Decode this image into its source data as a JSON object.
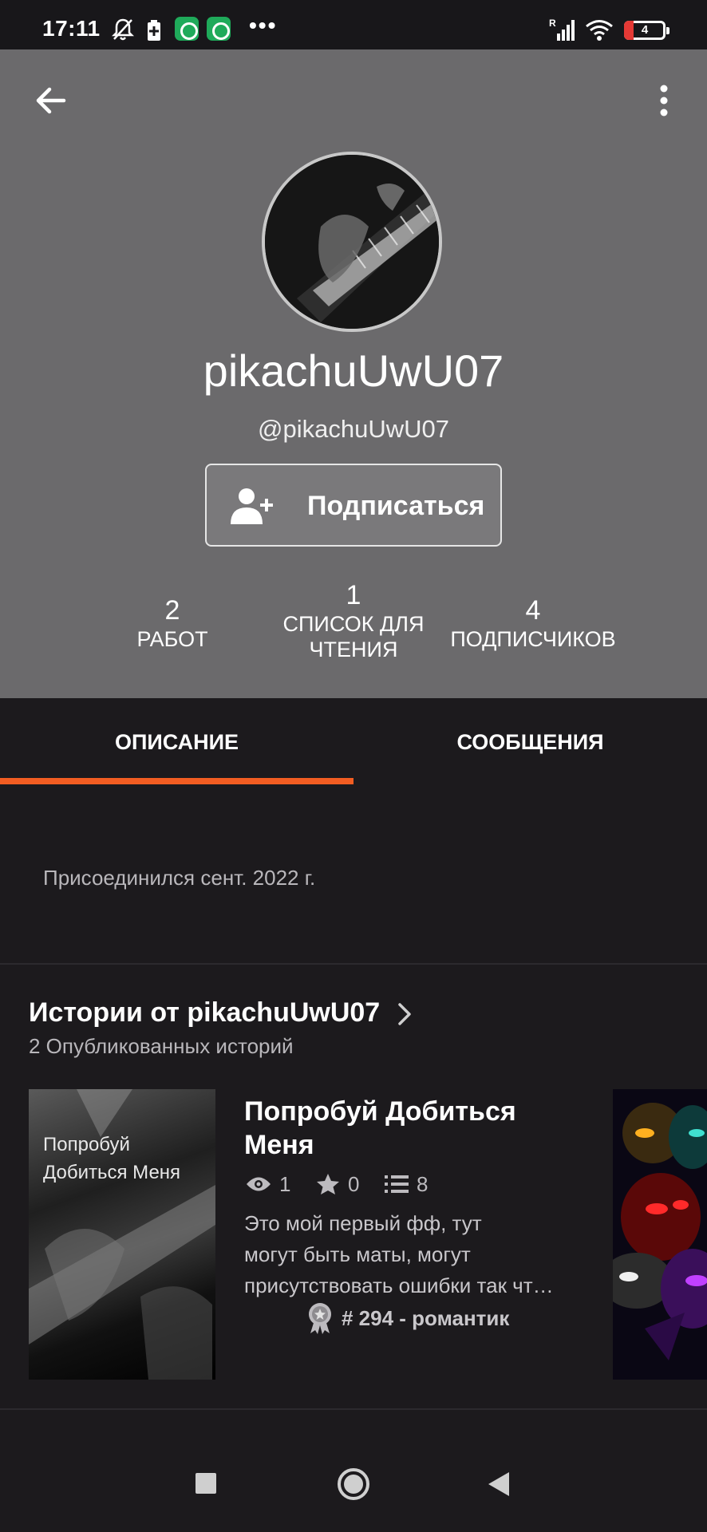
{
  "status_bar": {
    "time": "17:11",
    "battery": "4",
    "icons": [
      "bell-off-icon",
      "battery-saver-icon",
      "app-notification-icon",
      "app-notification-icon",
      "more-dots",
      "signal-icon",
      "wifi-icon",
      "battery-icon"
    ],
    "dots": "•••",
    "signal_badge": "R"
  },
  "header": {
    "display_name": "pikachuUwU07",
    "handle": "@pikachuUwU07",
    "follow_label": "Подписаться",
    "stats": [
      {
        "value": "2",
        "label": "РАБОТ"
      },
      {
        "value": "1",
        "label": "СПИСОК ДЛЯ ЧТЕНИЯ"
      },
      {
        "value": "4",
        "label": "ПОДПИСЧИКОВ"
      }
    ]
  },
  "tabs": [
    {
      "label": "ОПИСАНИЕ",
      "active": true
    },
    {
      "label": "СООБЩЕНИЯ",
      "active": false
    }
  ],
  "about": {
    "joined": "Присоединился сент. 2022 г."
  },
  "stories": {
    "title": "Истории от pikachuUwU07",
    "count": "2 Опубликованных историй",
    "items": [
      {
        "cover_text": "Попробуй Добиться Меня",
        "title": "Попробуй Добиться Меня",
        "reads": "1",
        "votes": "0",
        "parts": "8",
        "description_lines": [
          "Это мой первый фф, тут",
          "могут быть маты,  могут",
          "присутствовать ошибки так чт…"
        ],
        "rank": "# 294 - романтик"
      }
    ]
  },
  "colors": {
    "accent": "#f25d22",
    "header_bg": "#6b6a6c",
    "page_bg": "#1c1a1d"
  }
}
